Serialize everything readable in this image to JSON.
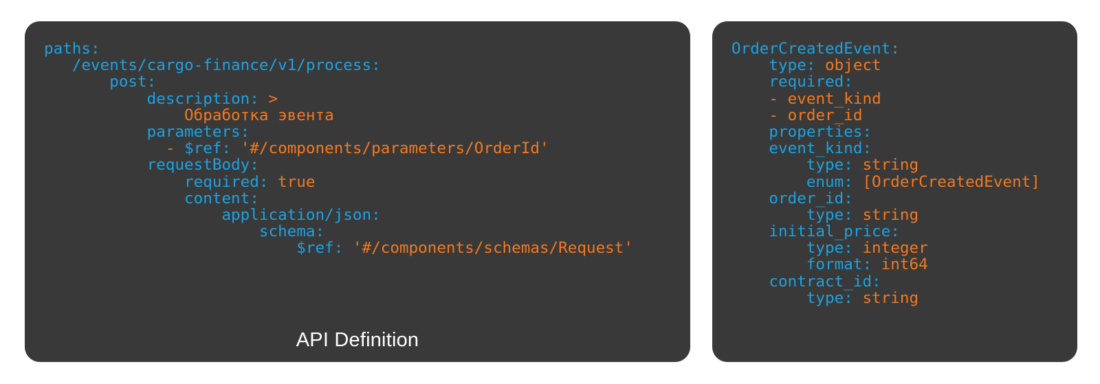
{
  "colors": {
    "background": "#ffffff",
    "panel_bg": "#393939",
    "key_blue": "#1CA2E2",
    "value_orange": "#F4791F",
    "caption_white": "#ffffff"
  },
  "panels": {
    "left": {
      "caption": "API Definition",
      "lines": [
        {
          "indent": 0,
          "segments": [
            {
              "text": "paths:",
              "color": "key"
            }
          ]
        },
        {
          "indent": 3,
          "segments": [
            {
              "text": "/events/cargo-finance/v1/process:",
              "color": "key"
            }
          ]
        },
        {
          "indent": 7,
          "segments": [
            {
              "text": "post:",
              "color": "key"
            }
          ]
        },
        {
          "indent": 11,
          "segments": [
            {
              "text": "description: ",
              "color": "key"
            },
            {
              "text": ">",
              "color": "val"
            }
          ]
        },
        {
          "indent": 15,
          "segments": [
            {
              "text": "Обработка эвента",
              "color": "val"
            }
          ]
        },
        {
          "indent": 11,
          "segments": [
            {
              "text": "parameters:",
              "color": "key"
            }
          ]
        },
        {
          "indent": 13,
          "segments": [
            {
              "text": "- ",
              "color": "val"
            },
            {
              "text": "$ref: ",
              "color": "key"
            },
            {
              "text": "'#/components/parameters/OrderId'",
              "color": "val"
            }
          ]
        },
        {
          "indent": 11,
          "segments": [
            {
              "text": "requestBody:",
              "color": "key"
            }
          ]
        },
        {
          "indent": 15,
          "segments": [
            {
              "text": "required: ",
              "color": "key"
            },
            {
              "text": "true",
              "color": "val"
            }
          ]
        },
        {
          "indent": 15,
          "segments": [
            {
              "text": "content:",
              "color": "key"
            }
          ]
        },
        {
          "indent": 19,
          "segments": [
            {
              "text": "application/json:",
              "color": "key"
            }
          ]
        },
        {
          "indent": 23,
          "segments": [
            {
              "text": "schema:",
              "color": "key"
            }
          ]
        },
        {
          "indent": 27,
          "segments": [
            {
              "text": "$ref: ",
              "color": "key"
            },
            {
              "text": "'#/components/schemas/Request'",
              "color": "val"
            }
          ]
        }
      ]
    },
    "right": {
      "caption": "",
      "lines": [
        {
          "indent": 0,
          "segments": [
            {
              "text": "OrderCreatedEvent:",
              "color": "key"
            }
          ]
        },
        {
          "indent": 4,
          "segments": [
            {
              "text": "type: ",
              "color": "key"
            },
            {
              "text": "object",
              "color": "val"
            }
          ]
        },
        {
          "indent": 4,
          "segments": [
            {
              "text": "required:",
              "color": "key"
            }
          ]
        },
        {
          "indent": 4,
          "segments": [
            {
              "text": "- ",
              "color": "val"
            },
            {
              "text": "event_kind",
              "color": "val"
            }
          ]
        },
        {
          "indent": 4,
          "segments": [
            {
              "text": "- ",
              "color": "val"
            },
            {
              "text": "order_id",
              "color": "val"
            }
          ]
        },
        {
          "indent": 4,
          "segments": [
            {
              "text": "properties:",
              "color": "key"
            }
          ]
        },
        {
          "indent": 4,
          "segments": [
            {
              "text": "event_kind:",
              "color": "key"
            }
          ]
        },
        {
          "indent": 8,
          "segments": [
            {
              "text": "type: ",
              "color": "key"
            },
            {
              "text": "string",
              "color": "val"
            }
          ]
        },
        {
          "indent": 8,
          "segments": [
            {
              "text": "enum: ",
              "color": "key"
            },
            {
              "text": "[OrderCreatedEvent]",
              "color": "val"
            }
          ]
        },
        {
          "indent": 4,
          "segments": [
            {
              "text": "order_id:",
              "color": "key"
            }
          ]
        },
        {
          "indent": 8,
          "segments": [
            {
              "text": "type: ",
              "color": "key"
            },
            {
              "text": "string",
              "color": "val"
            }
          ]
        },
        {
          "indent": 4,
          "segments": [
            {
              "text": "initial_price:",
              "color": "key"
            }
          ]
        },
        {
          "indent": 8,
          "segments": [
            {
              "text": "type: ",
              "color": "key"
            },
            {
              "text": "integer",
              "color": "val"
            }
          ]
        },
        {
          "indent": 8,
          "segments": [
            {
              "text": "format: ",
              "color": "key"
            },
            {
              "text": "int64",
              "color": "val"
            }
          ]
        },
        {
          "indent": 4,
          "segments": [
            {
              "text": "contract_id:",
              "color": "key"
            }
          ]
        },
        {
          "indent": 8,
          "segments": [
            {
              "text": "type: ",
              "color": "key"
            },
            {
              "text": "string",
              "color": "val"
            }
          ]
        }
      ]
    }
  }
}
